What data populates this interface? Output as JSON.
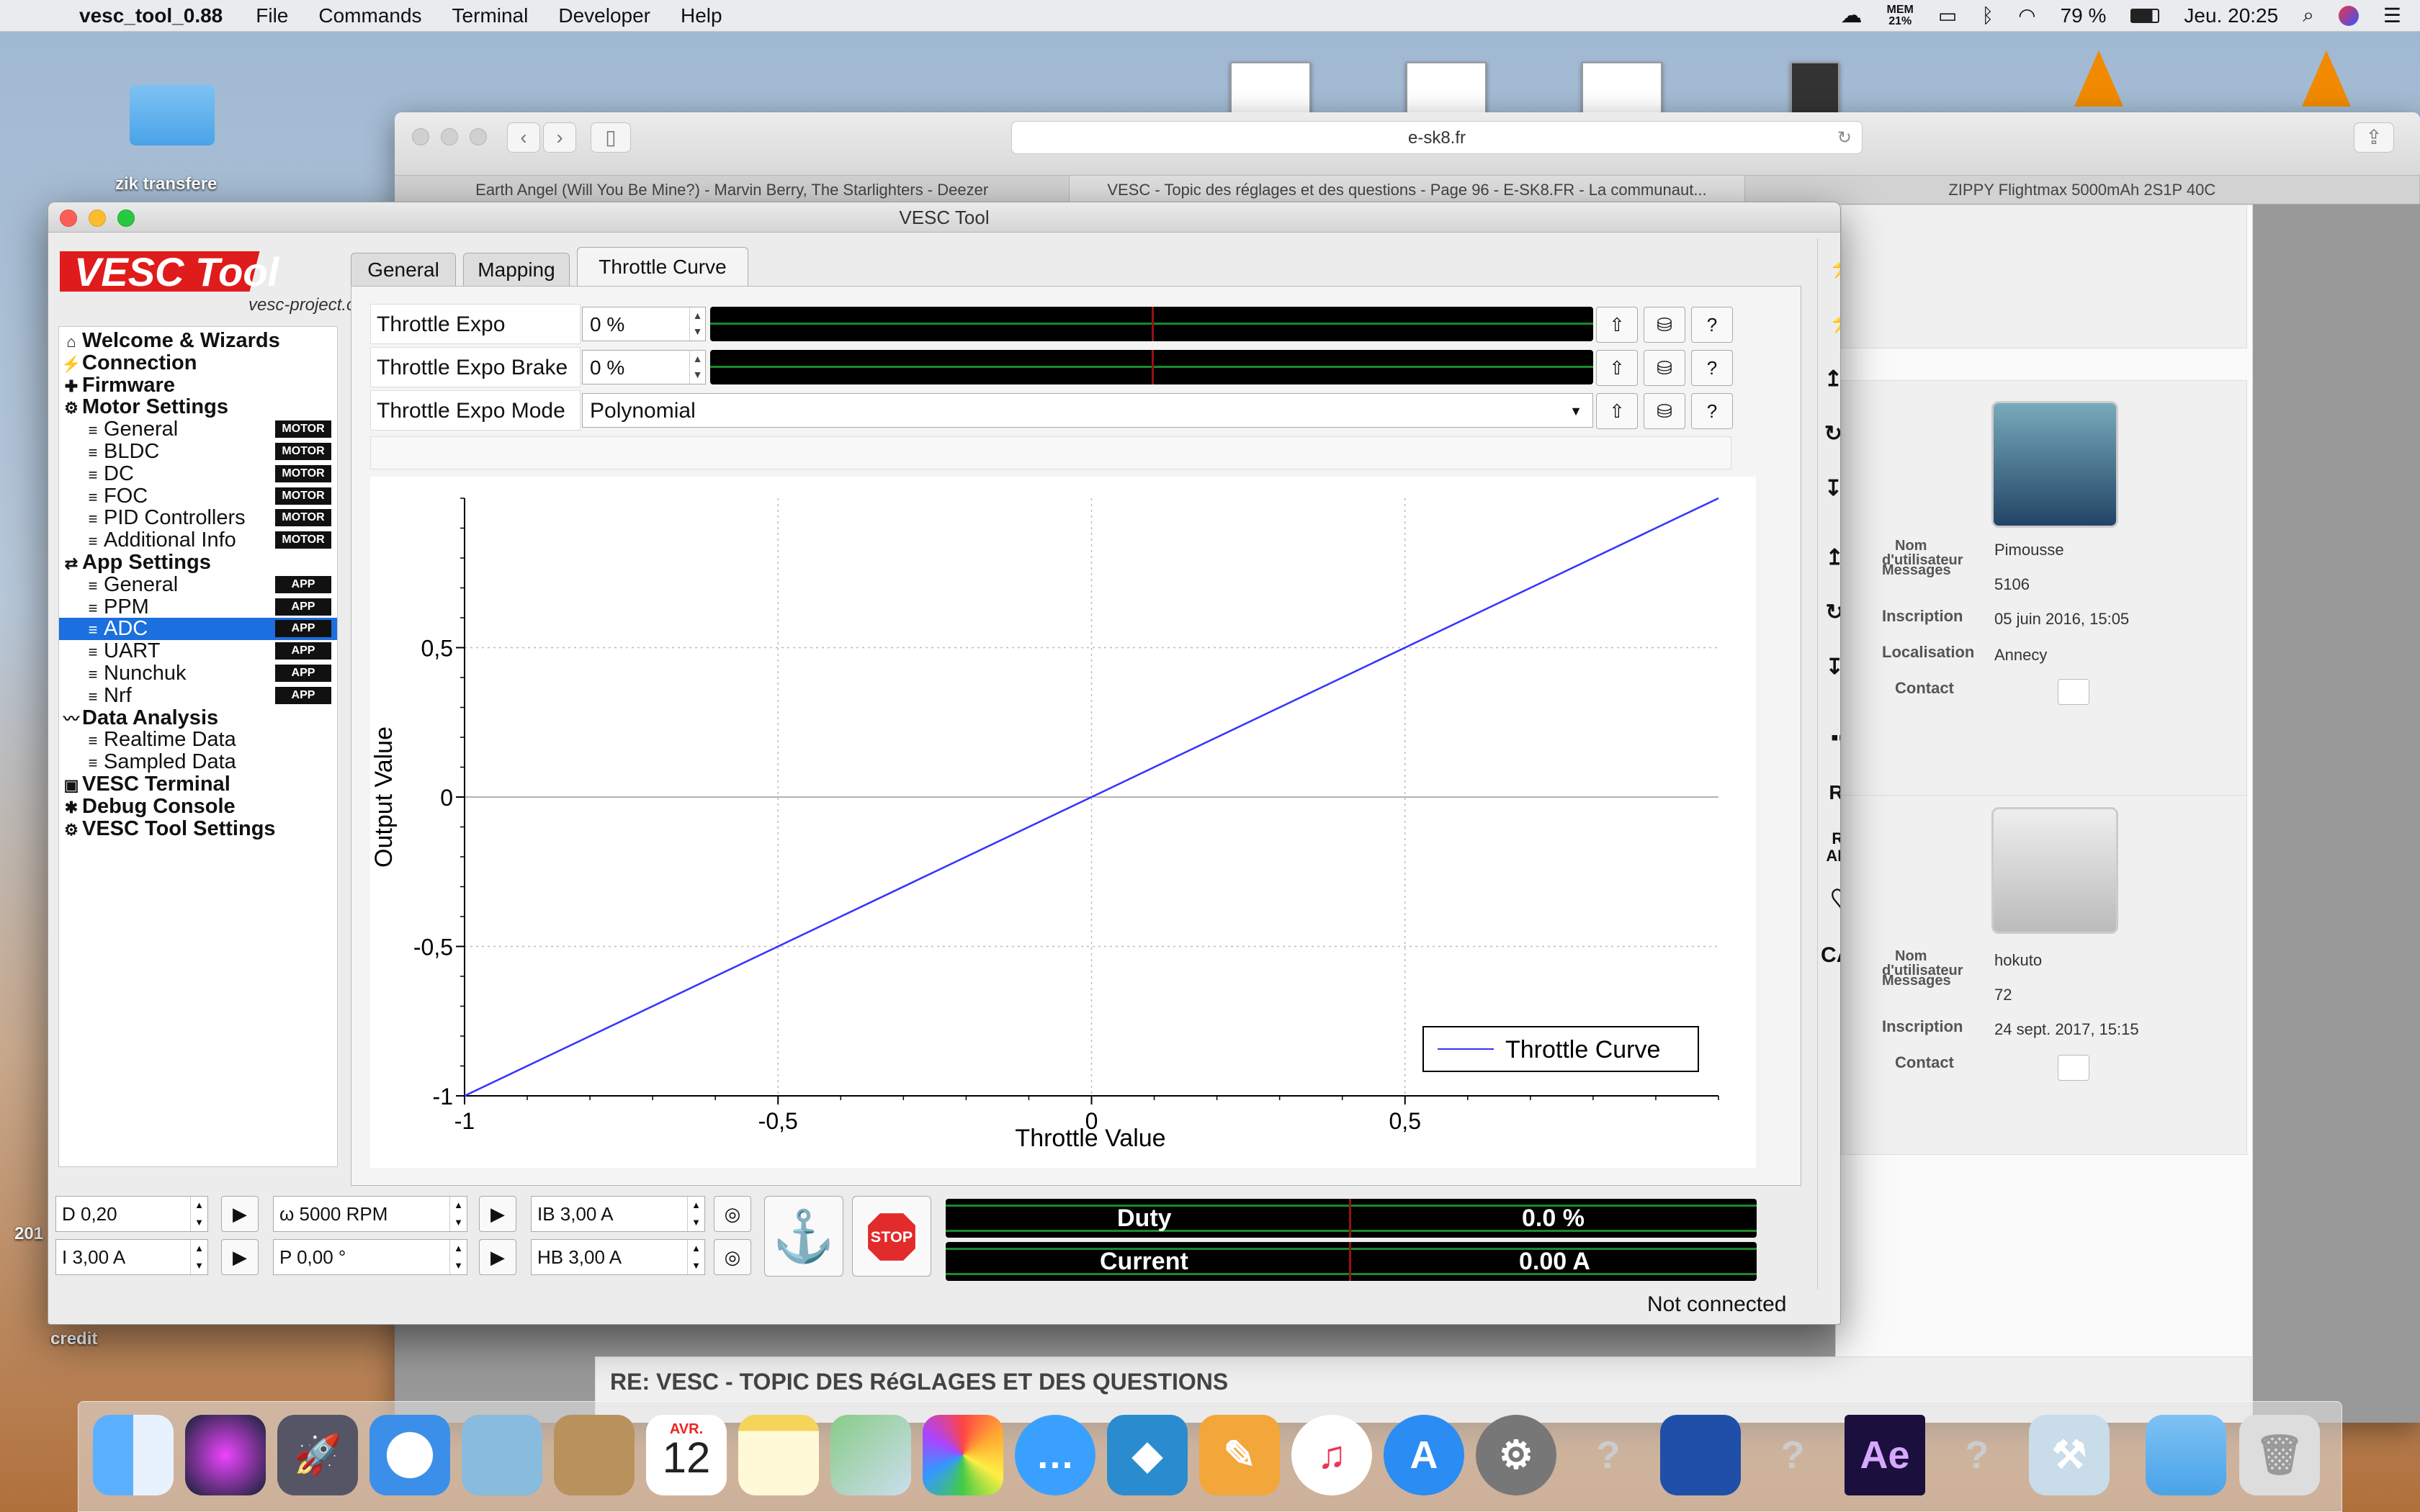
{
  "menubar": {
    "app_name": "vesc_tool_0.88",
    "items": [
      "File",
      "Commands",
      "Terminal",
      "Developer",
      "Help"
    ],
    "mem_label": "MEM",
    "mem_value": "21%",
    "battery": "79 %",
    "clock": "Jeu. 20:25"
  },
  "desktop": {
    "folder_label": "zik transfere",
    "side_number": "201",
    "credit_label": "credit"
  },
  "safari": {
    "address": "e-sk8.fr",
    "tabs": [
      "Earth Angel (Will You Be Mine?) - Marvin Berry, The Starlighters - Deezer",
      "VESC - Topic des réglages et des questions - Page 96 - E-SK8.FR - La communaut...",
      "ZIPPY Flightmax 5000mAh 2S1P 40C"
    ],
    "users": [
      {
        "username": "Pimousse",
        "messages": "5106",
        "inscription": "05 juin 2016, 15:05",
        "localisation": "Annecy"
      },
      {
        "username": "hokuto",
        "messages": "72",
        "inscription": "24 sept. 2017, 15:15"
      }
    ],
    "labels": {
      "nom": "Nom",
      "utilisateur": "d'utilisateur",
      "messages": "Messages",
      "inscription": "Inscription",
      "localisation": "Localisation",
      "contact": "Contact"
    },
    "post_title": "RE: VESC - TOPIC DES RéGLAGES ET DES QUESTIONS"
  },
  "vesc": {
    "window_title": "VESC Tool",
    "logo_text": "VESC Tool",
    "logo_url": "vesc-project.com",
    "tree": [
      {
        "label": "Welcome & Wizards",
        "level": 0
      },
      {
        "label": "Connection",
        "level": 0
      },
      {
        "label": "Firmware",
        "level": 0
      },
      {
        "label": "Motor Settings",
        "level": 0
      },
      {
        "label": "General",
        "level": 1,
        "badge": "MOTOR"
      },
      {
        "label": "BLDC",
        "level": 1,
        "badge": "MOTOR"
      },
      {
        "label": "DC",
        "level": 1,
        "badge": "MOTOR"
      },
      {
        "label": "FOC",
        "level": 1,
        "badge": "MOTOR"
      },
      {
        "label": "PID Controllers",
        "level": 1,
        "badge": "MOTOR"
      },
      {
        "label": "Additional Info",
        "level": 1,
        "badge": "MOTOR"
      },
      {
        "label": "App Settings",
        "level": 0
      },
      {
        "label": "General",
        "level": 1,
        "badge": "APP"
      },
      {
        "label": "PPM",
        "level": 1,
        "badge": "APP"
      },
      {
        "label": "ADC",
        "level": 1,
        "badge": "APP",
        "selected": true
      },
      {
        "label": "UART",
        "level": 1,
        "badge": "APP"
      },
      {
        "label": "Nunchuk",
        "level": 1,
        "badge": "APP"
      },
      {
        "label": "Nrf",
        "level": 1,
        "badge": "APP"
      },
      {
        "label": "Data Analysis",
        "level": 0
      },
      {
        "label": "Realtime Data",
        "level": 1
      },
      {
        "label": "Sampled Data",
        "level": 1
      },
      {
        "label": "VESC Terminal",
        "level": 0
      },
      {
        "label": "Debug Console",
        "level": 0
      },
      {
        "label": "VESC Tool Settings",
        "level": 0
      }
    ],
    "tabs": [
      "General",
      "Mapping",
      "Throttle Curve"
    ],
    "active_tab": "Throttle Curve",
    "params": [
      {
        "label": "Throttle Expo",
        "value": "0 %",
        "fraction": 0.5
      },
      {
        "label": "Throttle Expo Brake",
        "value": "0 %",
        "fraction": 0.5
      },
      {
        "label": "Throttle Expo Mode",
        "value": "Polynomial"
      }
    ],
    "bottom": {
      "d": "D 0,20",
      "i": "I 3,00 A",
      "rpm": "ω 5000 RPM",
      "pos": "P 0,00 °",
      "ib": "IB 3,00 A",
      "hb": "HB 3,00 A",
      "stop": "STOP",
      "duty_label": "Duty",
      "duty_value": "0.0 %",
      "current_label": "Current",
      "current_value": "0.00 A"
    },
    "status": "Not connected",
    "side_buttons": [
      "↥M",
      "↻M",
      "↧M",
      "↥A",
      "↻A",
      "↧A",
      "RT",
      "RT APP",
      "CAN"
    ]
  },
  "chart_data": {
    "type": "line",
    "xlabel": "Throttle Value",
    "ylabel": "Output Value",
    "xlim": [
      -1,
      1
    ],
    "ylim": [
      -1,
      1
    ],
    "x_ticks": [
      "-1",
      "-0,5",
      "0",
      "0,5"
    ],
    "y_ticks": [
      "0,5",
      "0",
      "-0,5",
      "-1"
    ],
    "grid": true,
    "legend_position": "bottom-right",
    "series": [
      {
        "name": "Throttle Curve",
        "color": "#3333ff",
        "x": [
          -1,
          -0.5,
          0,
          0.5,
          1
        ],
        "y": [
          -1,
          -0.5,
          0,
          0.5,
          1
        ]
      }
    ]
  },
  "dock": {
    "calendar_month": "AVR.",
    "calendar_day": "12",
    "ae_label": "Ae",
    "icons": [
      "finder-icon",
      "siri-icon",
      "launchpad-icon",
      "safari-icon",
      "mail-icon",
      "contacts-icon",
      "calendar-icon",
      "notes-icon",
      "maps-icon",
      "photos-icon",
      "messages-icon",
      "kodi-icon",
      "pages-icon",
      "itunes-icon",
      "app-store-icon",
      "system-preferences-icon",
      "unknown-app-icon",
      "app-icon",
      "unknown-app-icon",
      "after-effects-icon",
      "unknown-app-icon",
      "xcode-icon",
      "downloads-folder-icon",
      "trash-icon"
    ]
  }
}
